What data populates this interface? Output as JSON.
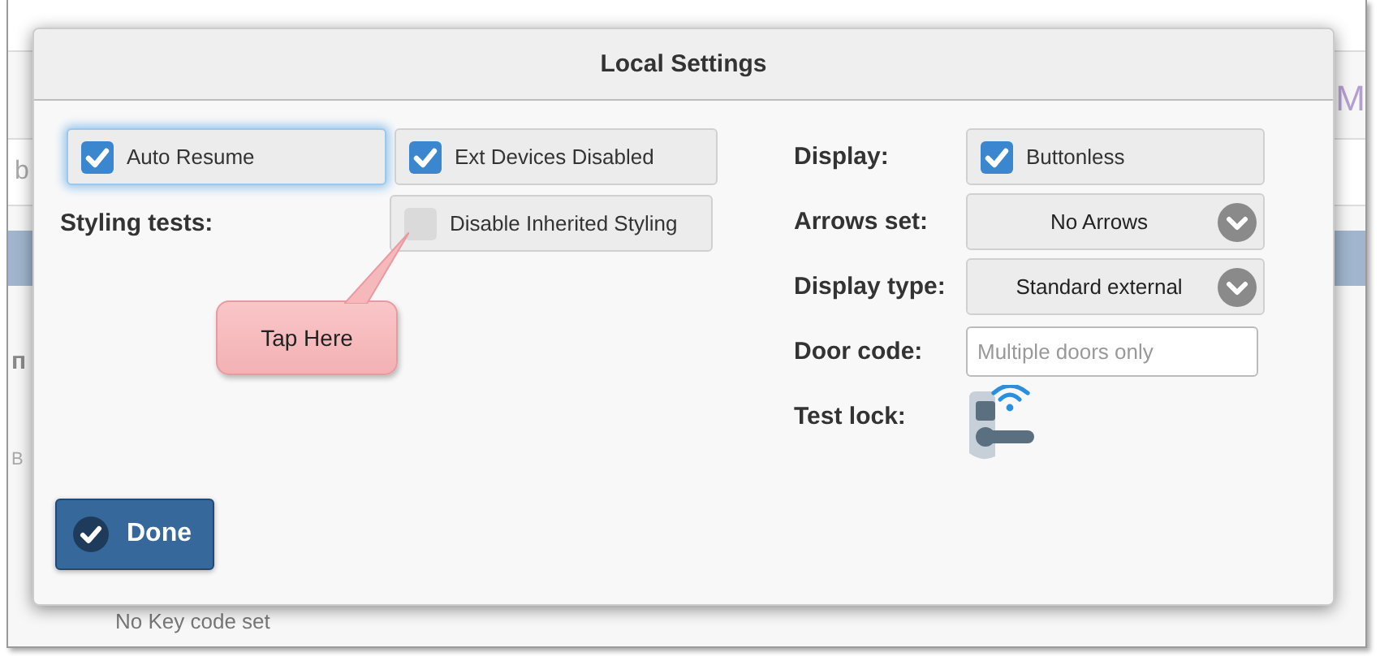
{
  "background": {
    "header_text": "M",
    "row_text": "b",
    "side_texts": [
      "п",
      "B"
    ],
    "footer_text": "No Key code set"
  },
  "dialog": {
    "title": "Local Settings",
    "options": [
      {
        "label": "Auto Resume",
        "checked": true,
        "focused": true
      },
      {
        "label": "Ext Devices Disabled",
        "checked": true,
        "focused": false
      }
    ],
    "styling_tests": {
      "label": "Styling tests:",
      "option": {
        "label": "Disable Inherited Styling",
        "checked": false
      }
    },
    "callout": "Tap Here",
    "settings": [
      {
        "kind": "checkbox",
        "label": "Display:",
        "value": "Buttonless",
        "checked": true
      },
      {
        "kind": "select",
        "label": "Arrows set:",
        "value": "No Arrows"
      },
      {
        "kind": "select",
        "label": "Display type:",
        "value": "Standard external"
      },
      {
        "kind": "input",
        "label": "Door code:",
        "placeholder": "Multiple doors only"
      },
      {
        "kind": "lock",
        "label": "Test lock:"
      }
    ],
    "done_button": "Done"
  }
}
